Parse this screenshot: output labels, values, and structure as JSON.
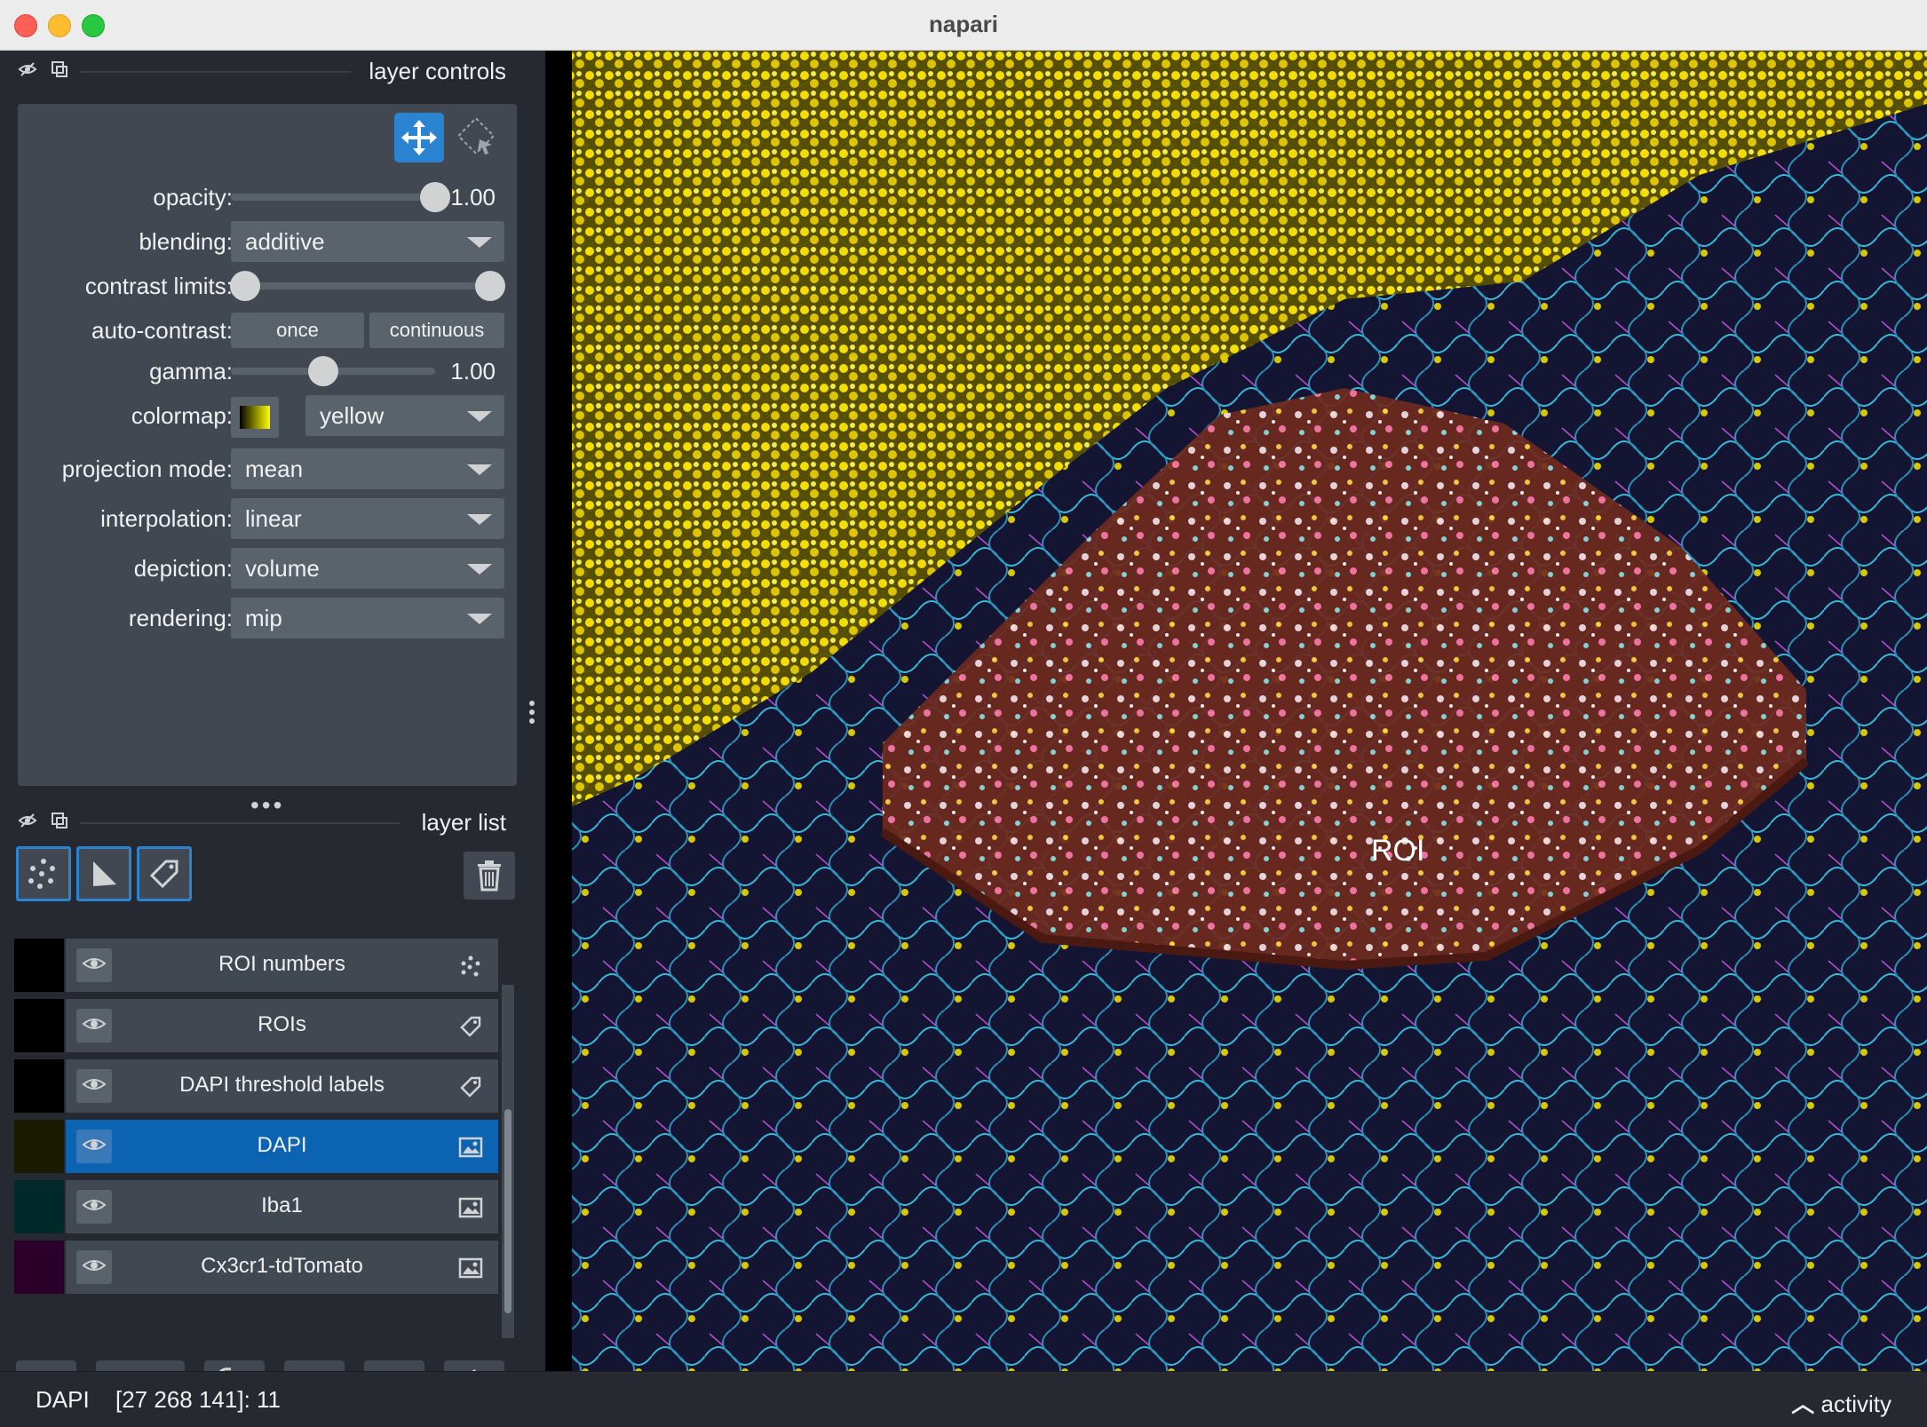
{
  "window": {
    "title": "napari"
  },
  "layer_controls": {
    "title": "layer controls",
    "opacity_label": "opacity:",
    "opacity_value": "1.00",
    "opacity_fraction": 1.0,
    "blending_label": "blending:",
    "blending_value": "additive",
    "contrast_label": "contrast limits:",
    "contrast_low": 0.0,
    "contrast_high": 1.0,
    "auto_contrast_label": "auto-contrast:",
    "once_label": "once",
    "continuous_label": "continuous",
    "gamma_label": "gamma:",
    "gamma_value": "1.00",
    "gamma_fraction": 0.45,
    "colormap_label": "colormap:",
    "colormap_value": "yellow",
    "projection_label": "projection mode:",
    "projection_value": "mean",
    "interpolation_label": "interpolation:",
    "interpolation_value": "linear",
    "depiction_label": "depiction:",
    "depiction_value": "volume",
    "rendering_label": "rendering:",
    "rendering_value": "mip"
  },
  "layer_list": {
    "title": "layer list",
    "layers": [
      {
        "name": "ROI numbers",
        "type": "points-icon",
        "thumb": "#000000",
        "selected": false
      },
      {
        "name": "ROIs",
        "type": "labels-icon",
        "thumb": "#000000",
        "selected": false
      },
      {
        "name": "DAPI threshold labels",
        "type": "labels-icon",
        "thumb": "#000000",
        "selected": false
      },
      {
        "name": "DAPI",
        "type": "image-icon",
        "thumb": "#1a1a00",
        "selected": true
      },
      {
        "name": "Iba1",
        "type": "image-icon",
        "thumb": "#002a2a",
        "selected": false
      },
      {
        "name": "Cx3cr1-tdTomato",
        "type": "image-icon",
        "thumb": "#2a002a",
        "selected": false
      }
    ]
  },
  "canvas": {
    "roi_label": "ROI"
  },
  "status": {
    "layer": "DAPI",
    "coords": "[27 268 141]: 11",
    "activity": "activity"
  },
  "colors": {
    "accent": "#2a84d2",
    "selected": "#0b63b2",
    "panel": "#414851",
    "background": "#262930"
  }
}
